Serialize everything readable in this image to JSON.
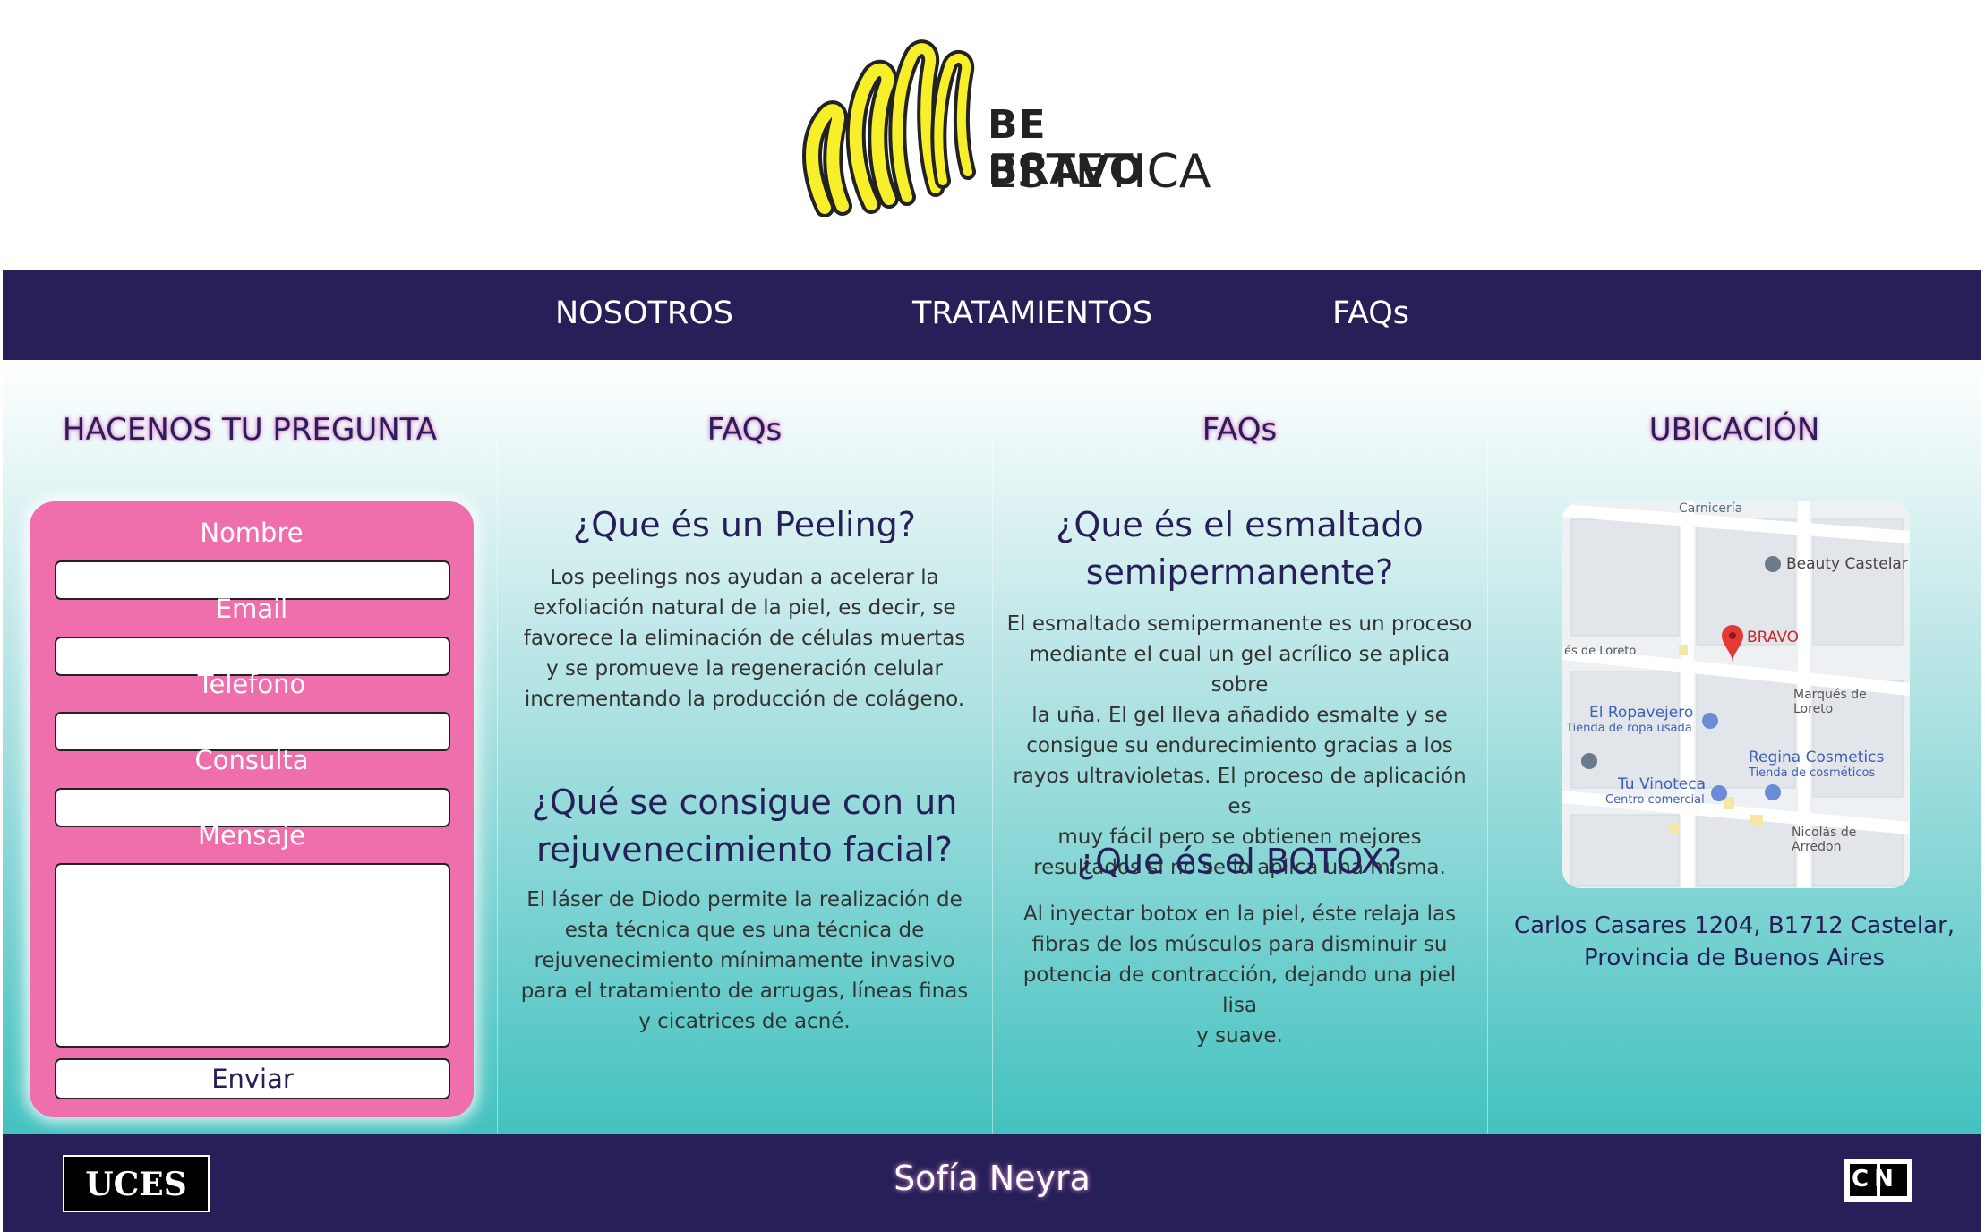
{
  "brand": {
    "line1": "BE BRAVO",
    "line2": "ESTETICA",
    "logo_color": "#f6ef2a"
  },
  "nav": {
    "items": [
      {
        "label": "NOSOTROS"
      },
      {
        "label": "TRATAMIENTOS"
      },
      {
        "label": "FAQs"
      }
    ],
    "background": "#272058"
  },
  "contact_form": {
    "title": "HACENOS TU PREGUNTA",
    "fields": [
      {
        "label": "Nombre",
        "value": ""
      },
      {
        "label": "Email",
        "value": ""
      },
      {
        "label": "Telefono",
        "value": ""
      },
      {
        "label": "Consulta",
        "value": ""
      }
    ],
    "message_label": "Mensaje",
    "message_value": "",
    "submit_label": "Enviar",
    "background": "#ee6fab"
  },
  "faq_left": {
    "title": "FAQs",
    "items": [
      {
        "question": "¿Que és un Peeling?",
        "answer_lines": [
          "Los peelings nos ayudan a acelerar la",
          "exfoliación natural de la piel, es decir, se",
          "favorece la eliminación de células muertas",
          "y se promueve la regeneración celular",
          "incrementando la producción de colágeno."
        ]
      },
      {
        "question_lines": [
          "¿Qué se consigue con un",
          "rejuvenecimiento facial?"
        ],
        "answer_lines": [
          "El láser de Diodo permite la realización de",
          "esta técnica que es una técnica de",
          "rejuvenecimiento mínimamente invasivo",
          "para el tratamiento de arrugas, líneas finas",
          "y cicatrices de acné."
        ]
      }
    ]
  },
  "faq_right": {
    "title": "FAQs",
    "items": [
      {
        "question_lines": [
          "¿Que és el esmaltado",
          "semipermanente?"
        ],
        "answer_lines": [
          "El esmaltado semipermanente es un proceso",
          "mediante el cual un gel acrílico se aplica sobre",
          "la uña. El gel lleva añadido esmalte y se",
          "consigue su endurecimiento gracias a los",
          "rayos ultravioletas. El proceso de aplicación es",
          "muy fácil pero se obtienen mejores",
          "resultados si no se lo aplica una misma."
        ]
      },
      {
        "question": "¿Que és el BOTOX?",
        "answer_lines": [
          "Al inyectar botox en la piel, éste relaja las",
          "fibras de los músculos para disminuir su",
          "potencia de contracción, dejando una piel lisa",
          "y suave."
        ]
      }
    ]
  },
  "location": {
    "title": "UBICACIÓN",
    "map_labels": {
      "carniceria": "Carnicería",
      "beauty": "Beauty Castelar",
      "bravo": "BRAVO",
      "loreto_left": "és de Loreto",
      "loreto_right": "Marqués de Loreto",
      "ropavejero": "El Ropavejero",
      "ropavejero_sub": "Tienda de ropa usada",
      "regina": "Regina Cosmetics",
      "regina_sub": "Tienda de cosméticos",
      "vinoteca": "Tu Vinoteca",
      "vinoteca_sub": "Centro comercial",
      "arredondo": "Nicolás de Arredon"
    },
    "address_lines": [
      "Carlos Casares 1204, B1712 Castelar,",
      "Provincia de Buenos Aires"
    ]
  },
  "footer": {
    "left_logo": "UCES",
    "name": "Sofía Neyra",
    "right_logo": "CN"
  }
}
